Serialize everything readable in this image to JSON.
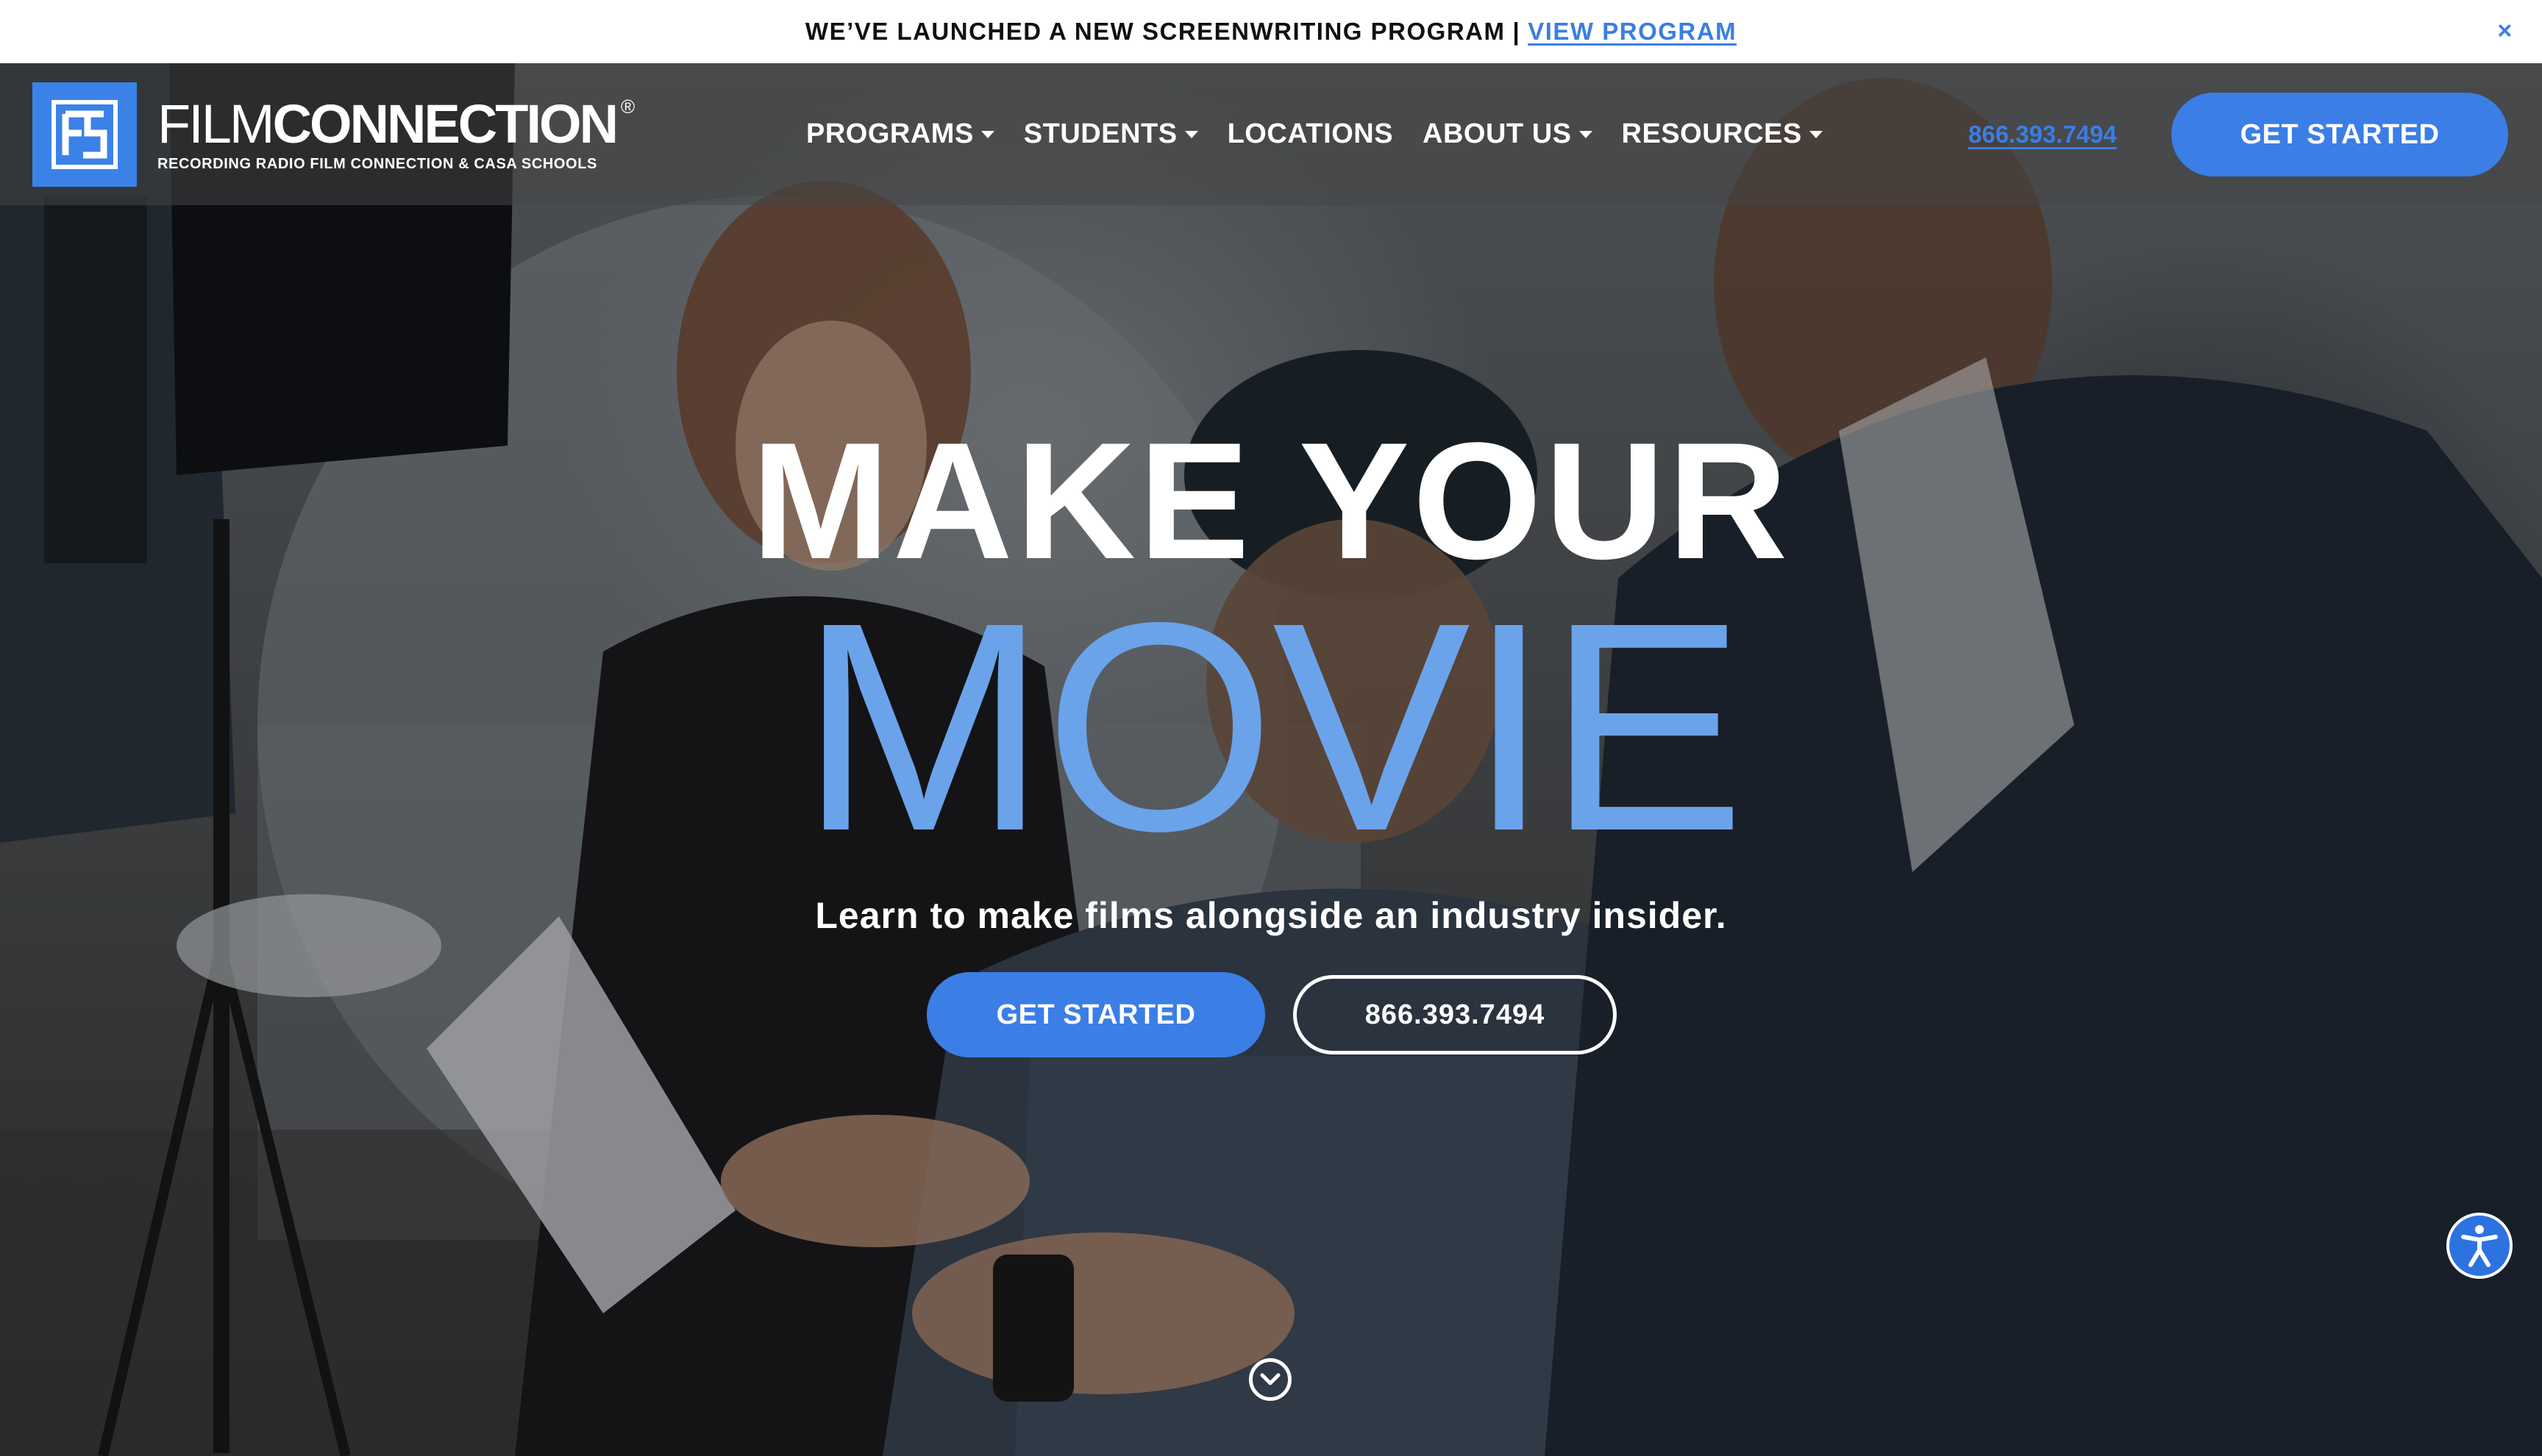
{
  "announcement": {
    "text": "WE’VE LAUNCHED A NEW SCREENWRITING PROGRAM",
    "separator": "|",
    "link": "VIEW PROGRAM",
    "close": "×"
  },
  "header": {
    "logo": {
      "name_thin": "FILM",
      "name_bold": "CONNECTION",
      "registered": "®",
      "tagline": "RECORDING RADIO FILM CONNECTION & CASA SCHOOLS"
    },
    "nav": [
      {
        "label": "PROGRAMS",
        "dropdown": true
      },
      {
        "label": "STUDENTS",
        "dropdown": true
      },
      {
        "label": "LOCATIONS",
        "dropdown": false
      },
      {
        "label": "ABOUT US",
        "dropdown": true
      },
      {
        "label": "RESOURCES",
        "dropdown": true
      }
    ],
    "phone": "866.393.7494",
    "cta": "GET STARTED"
  },
  "hero": {
    "headline_line1": "MAKE YOUR",
    "headline_line2": "MOVIE",
    "subheadline": "Learn to make films alongside an industry insider.",
    "primary_cta": "GET STARTED",
    "secondary_cta": "866.393.7494"
  },
  "icons": {
    "scroll": "chevron-down-circle-icon",
    "accessibility": "accessibility-icon",
    "close": "close-icon"
  },
  "colors": {
    "accent": "#3b7ee6",
    "headline_accent": "#6ba3ea",
    "link": "#3a7ee3"
  }
}
